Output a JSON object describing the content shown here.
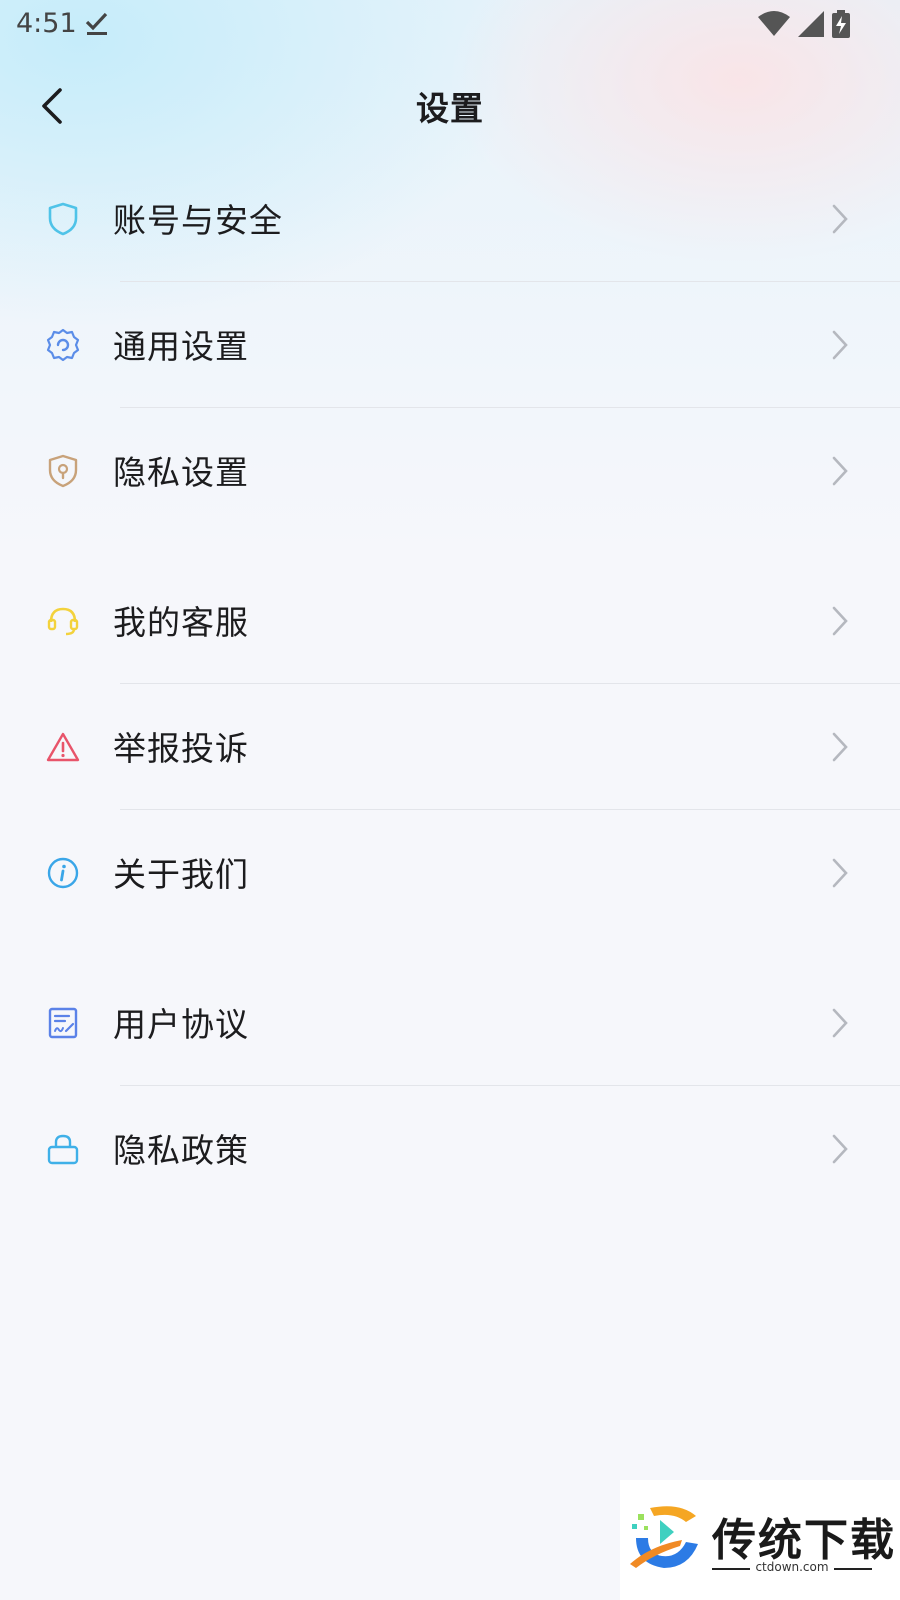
{
  "status_bar": {
    "time": "4:51",
    "icons": [
      "download-done-icon",
      "wifi-icon",
      "signal-icon",
      "battery-charging-icon"
    ]
  },
  "header": {
    "title": "设置",
    "back_icon": "chevron-left-icon"
  },
  "settings_groups": [
    {
      "items": [
        {
          "label": "账号与安全",
          "icon": "shield-icon",
          "color": "#4fc3e8"
        },
        {
          "label": "通用设置",
          "icon": "gear-icon",
          "color": "#5b8de8"
        },
        {
          "label": "隐私设置",
          "icon": "shield-lock-icon",
          "color": "#c8a27a"
        }
      ]
    },
    {
      "items": [
        {
          "label": "我的客服",
          "icon": "headset-icon",
          "color": "#f3d23c"
        },
        {
          "label": "举报投诉",
          "icon": "warning-icon",
          "color": "#e8546a"
        },
        {
          "label": "关于我们",
          "icon": "info-icon",
          "color": "#3aa6e8"
        }
      ]
    },
    {
      "items": [
        {
          "label": "用户协议",
          "icon": "document-sign-icon",
          "color": "#5b82e8"
        },
        {
          "label": "隐私政策",
          "icon": "lock-icon",
          "color": "#3fb0e8"
        }
      ]
    }
  ],
  "watermark": {
    "brand": "传统下载",
    "site": "ctdown.com"
  }
}
